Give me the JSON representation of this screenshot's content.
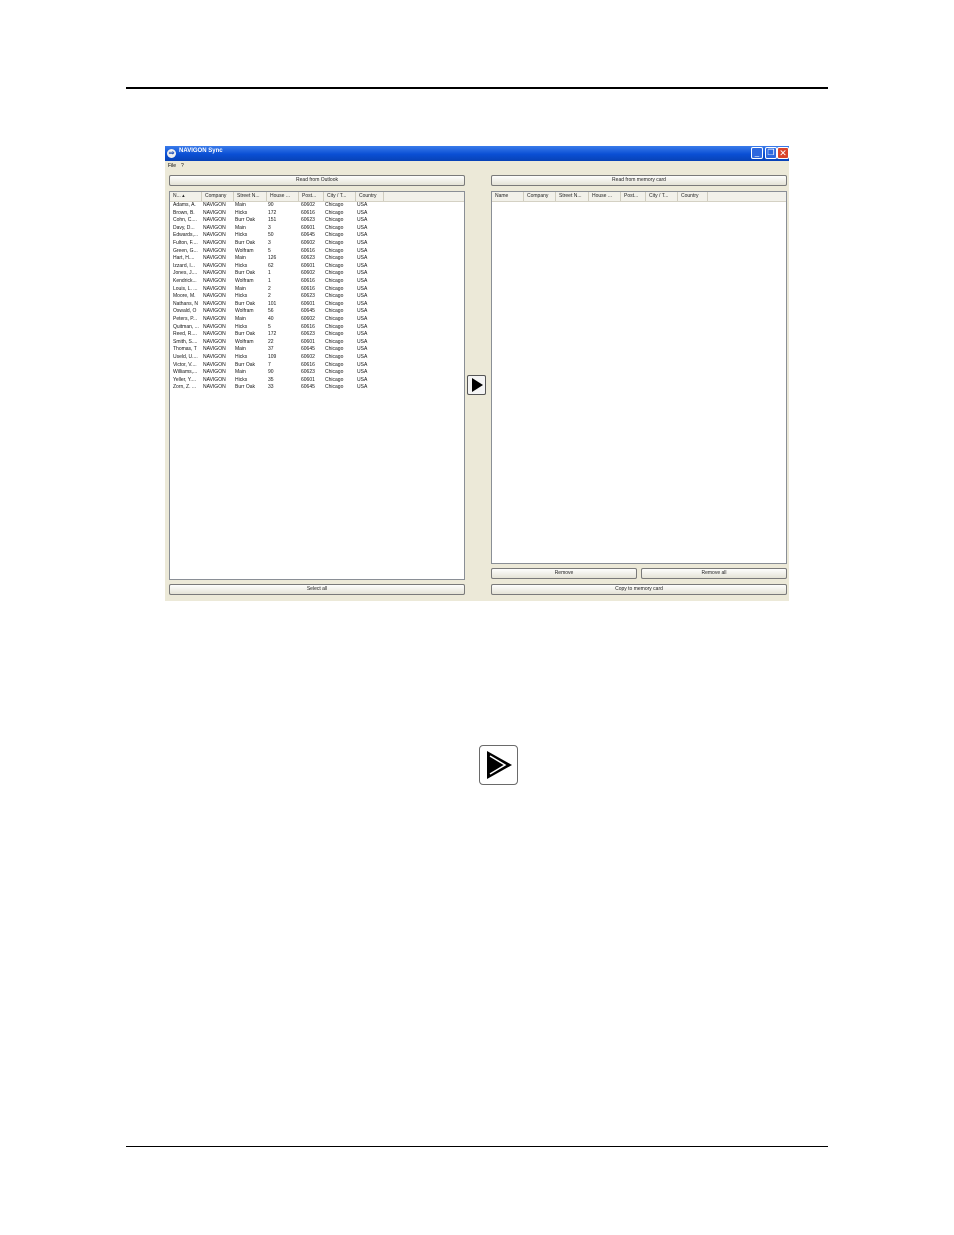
{
  "window": {
    "title": "NAVIGON Sync",
    "menu": [
      "File",
      "?"
    ]
  },
  "left_panel": {
    "read_button": "Read from Outlook",
    "columns": [
      "N...",
      "Company",
      "Street N...",
      "House ...",
      "Post...",
      "City / T...",
      "Country"
    ],
    "rows": [
      [
        "Adams, A.",
        "NAVIGON",
        "Main",
        "90",
        "60602",
        "Chicago",
        "USA"
      ],
      [
        "Brown, B.",
        "NAVIGON",
        "Hicks",
        "172",
        "60616",
        "Chicago",
        "USA"
      ],
      [
        "Cohn, C....",
        "NAVIGON",
        "Burr Oak",
        "151",
        "60623",
        "Chicago",
        "USA"
      ],
      [
        "Davy, D...",
        "NAVIGON",
        "Main",
        "3",
        "60601",
        "Chicago",
        "USA"
      ],
      [
        "Edwards,...",
        "NAVIGON",
        "Hicks",
        "50",
        "60645",
        "Chicago",
        "USA"
      ],
      [
        "Fulton, F....",
        "NAVIGON",
        "Burr Oak",
        "3",
        "60602",
        "Chicago",
        "USA"
      ],
      [
        "Green, G...",
        "NAVIGON",
        "Wolfram",
        "5",
        "60616",
        "Chicago",
        "USA"
      ],
      [
        "Hart, H....",
        "NAVIGON",
        "Main",
        "126",
        "60623",
        "Chicago",
        "USA"
      ],
      [
        "Izzard, I...",
        "NAVIGON",
        "Hicks",
        "62",
        "60601",
        "Chicago",
        "USA"
      ],
      [
        "Jones, J....",
        "NAVIGON",
        "Burr Oak",
        "1",
        "60602",
        "Chicago",
        "USA"
      ],
      [
        "Kendrick...",
        "NAVIGON",
        "Wolfram",
        "1",
        "60616",
        "Chicago",
        "USA"
      ],
      [
        "Louis, L. ...",
        "NAVIGON",
        "Main",
        "2",
        "60616",
        "Chicago",
        "USA"
      ],
      [
        "Moore, M.",
        "NAVIGON",
        "Hicks",
        "2",
        "60623",
        "Chicago",
        "USA"
      ],
      [
        "Nathans, N",
        "NAVIGON",
        "Burr Oak",
        "101",
        "60601",
        "Chicago",
        "USA"
      ],
      [
        "Oswald, O",
        "NAVIGON",
        "Wolfram",
        "56",
        "60645",
        "Chicago",
        "USA"
      ],
      [
        "Peters, P...",
        "NAVIGON",
        "Main",
        "40",
        "60602",
        "Chicago",
        "USA"
      ],
      [
        "Quitman, ...",
        "NAVIGON",
        "Hicks",
        "5",
        "60616",
        "Chicago",
        "USA"
      ],
      [
        "Reed, R....",
        "NAVIGON",
        "Burr Oak",
        "172",
        "60623",
        "Chicago",
        "USA"
      ],
      [
        "Smith, S....",
        "NAVIGON",
        "Wolfram",
        "22",
        "60601",
        "Chicago",
        "USA"
      ],
      [
        "Thomas, T",
        "NAVIGON",
        "Main",
        "37",
        "60645",
        "Chicago",
        "USA"
      ],
      [
        "Useld, U....",
        "NAVIGON",
        "Hicks",
        "109",
        "60602",
        "Chicago",
        "USA"
      ],
      [
        "Victor, V....",
        "NAVIGON",
        "Burr Oak",
        "7",
        "60616",
        "Chicago",
        "USA"
      ],
      [
        "Williams,...",
        "NAVIGON",
        "Main",
        "90",
        "60623",
        "Chicago",
        "USA"
      ],
      [
        "Yeller, Y....",
        "NAVIGON",
        "Hicks",
        "35",
        "60601",
        "Chicago",
        "USA"
      ],
      [
        "Zorn, Z. ...",
        "NAVIGON",
        "Burr Oak",
        "33",
        "60645",
        "Chicago",
        "USA"
      ]
    ],
    "select_all_button": "Select all"
  },
  "right_panel": {
    "read_button": "Read from memory card",
    "columns": [
      "Name",
      "Company",
      "Street N...",
      "House ...",
      "Post...",
      "City / T...",
      "Country"
    ],
    "remove_button": "Remove",
    "remove_all_button": "Remove all",
    "copy_button": "Copy to memory card"
  },
  "icons": {
    "transfer": "play-arrow-icon",
    "window_controls": [
      "minimize-icon",
      "restore-icon",
      "close-icon"
    ]
  }
}
